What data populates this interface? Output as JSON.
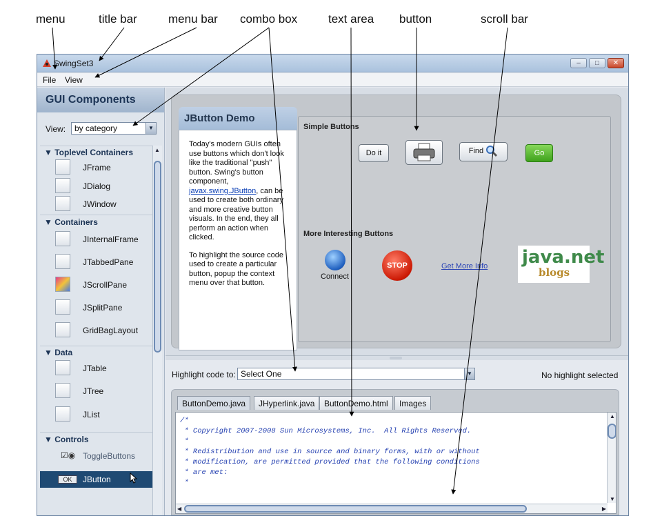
{
  "callouts": {
    "menu": "menu",
    "title_bar": "title bar",
    "menu_bar": "menu bar",
    "combo_box": "combo box",
    "text_area": "text area",
    "button": "button",
    "scroll_bar": "scroll bar"
  },
  "window": {
    "title": "SwingSet3"
  },
  "menubar": {
    "items": [
      {
        "label": "File"
      },
      {
        "label": "View"
      }
    ]
  },
  "sidebar": {
    "header": "GUI Components",
    "view_label": "View:",
    "view_combo": "by category",
    "categories": [
      {
        "label": "Toplevel Containers",
        "items": [
          "JFrame",
          "JDialog",
          "JWindow"
        ]
      },
      {
        "label": "Containers",
        "items": [
          "JInternalFrame",
          "JTabbedPane",
          "JScrollPane",
          "JSplitPane",
          "GridBagLayout"
        ]
      },
      {
        "label": "Data",
        "items": [
          "JTable",
          "JTree",
          "JList"
        ]
      },
      {
        "label": "Controls",
        "items": [
          "ToggleButtons",
          "JButton"
        ]
      }
    ],
    "selected": "JButton",
    "selected_icon_text": "OK"
  },
  "demo": {
    "title": "JButton Demo",
    "description_p1_before": "Today's modern GUIs often use buttons which don't look like the traditional \"push\" button. Swing's button component,",
    "description_link": "javax.swing.JButton",
    "description_p1_after": ", can be used to create both ordinary and more creative button visuals. In the end, they all perform an action when clicked.",
    "description_p2": "To highlight the source code used to create a particular button, popup the context menu over that button.",
    "simple_buttons_title": "Simple Buttons",
    "do_it": "Do it",
    "find": "Find",
    "go": "Go",
    "more_title": "More Interesting Buttons",
    "connect": "Connect",
    "stop": "STOP",
    "get_more_info": "Get More Info",
    "javanet_top": "java.net",
    "javanet_bottom": "blogs"
  },
  "code_panel": {
    "highlight_label": "Highlight code to:",
    "highlight_combo": "Select One",
    "status": "No highlight selected",
    "tabs": [
      "ButtonDemo.java",
      "JHyperlink.java",
      "ButtonDemo.html",
      "Images"
    ],
    "active_tab": "ButtonDemo.java",
    "lines": [
      "/*",
      " * Copyright 2007-2008 Sun Microsystems, Inc.  All Rights Reserved.",
      " *",
      " * Redistribution and use in source and binary forms, with or without",
      " * modification, are permitted provided that the following conditions",
      " * are met:",
      " *"
    ]
  },
  "colors": {
    "titlebar": "#aac2dd",
    "sidebar_selected": "#1f4a73",
    "go_button": "#3fa21c",
    "code_text": "#233fb0",
    "link": "#0b3fb5"
  }
}
